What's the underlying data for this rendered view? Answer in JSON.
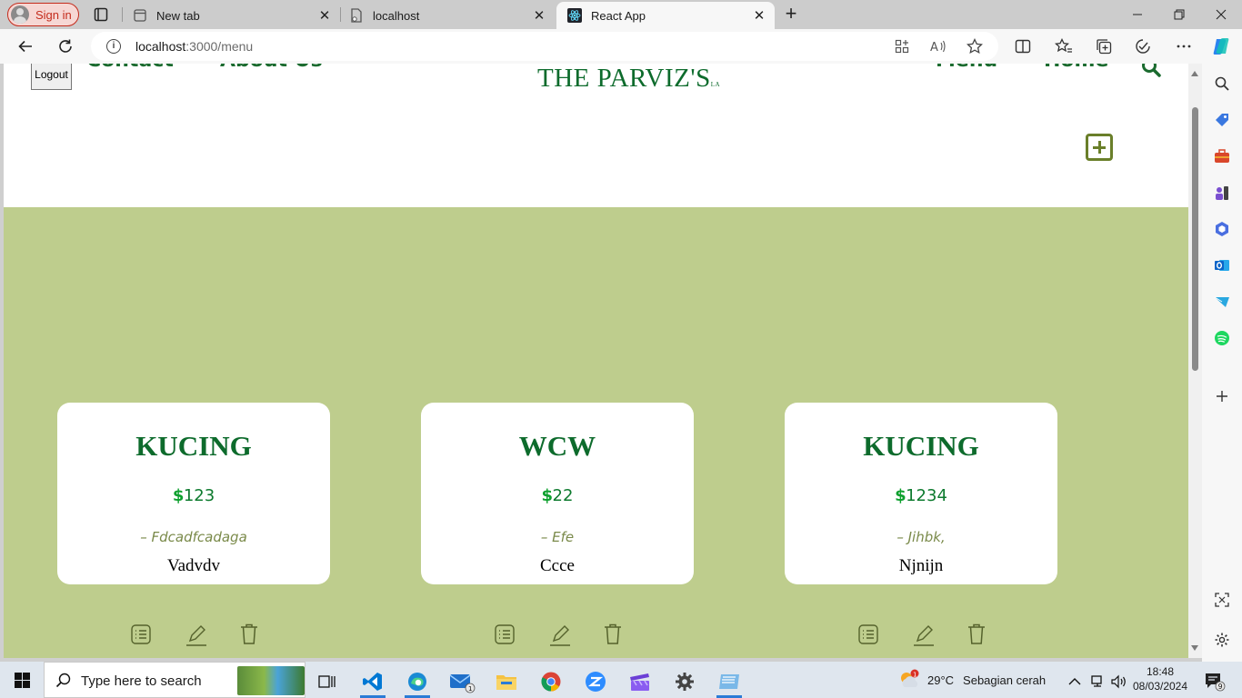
{
  "browser": {
    "sign_in_label": "Sign in",
    "tabs": [
      {
        "title": "New tab",
        "icon": "new-tab-page-icon"
      },
      {
        "title": "localhost",
        "icon": "page-icon"
      },
      {
        "title": "React App",
        "icon": "react-icon"
      }
    ],
    "url_host": "localhost",
    "url_path": ":3000/menu"
  },
  "page": {
    "logout_label": "Logout",
    "nav_left": [
      "Contact",
      "About Us"
    ],
    "brand": "THE PARVIZ'S",
    "brand_suffix": "LA",
    "nav_right": [
      "Menu",
      "Home"
    ],
    "accent": "#0d6b2c",
    "menu_bg": "#becd8d"
  },
  "menu_items": [
    {
      "name": "KUCING",
      "price": "123",
      "description": "– Fdcadfcadaga",
      "subtitle": "Vadvdv"
    },
    {
      "name": "WCW",
      "price": "22",
      "description": "– Efe",
      "subtitle": "Ccce"
    },
    {
      "name": "KUCING",
      "price": "1234",
      "description": "– Jihbk,",
      "subtitle": "Njnijn"
    }
  ],
  "taskbar": {
    "search_placeholder": "Type here to search",
    "mail_badge": "1",
    "weather_temp": "29°C",
    "weather_text": "Sebagian cerah",
    "weather_badge": "1",
    "time": "18:48",
    "date": "08/03/2024",
    "notification_count": "9"
  }
}
